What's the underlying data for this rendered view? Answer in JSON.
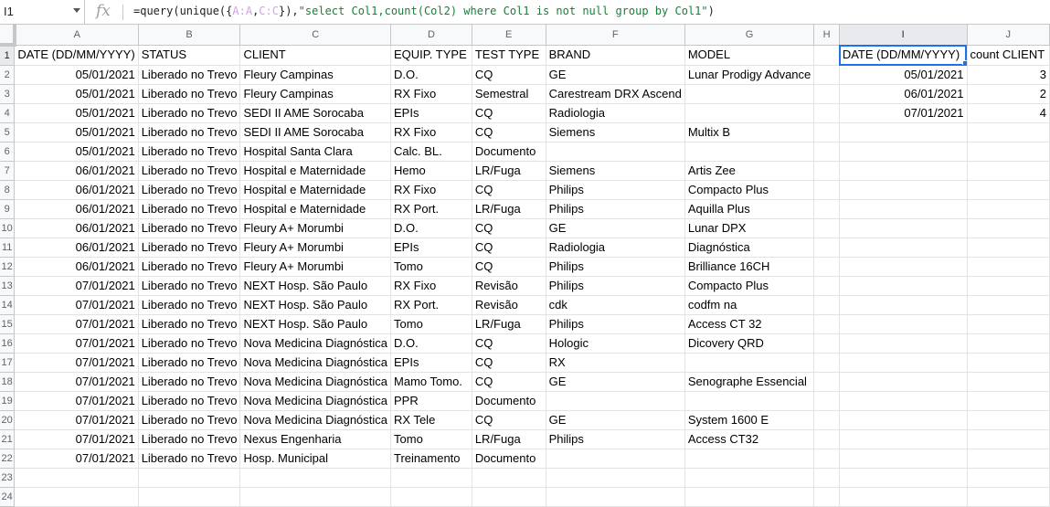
{
  "formula_bar": {
    "name_box": "I1",
    "fx_label": "fx",
    "formula_prefix": "=query(unique({",
    "formula_range1": "A:A",
    "formula_comma": ",",
    "formula_range2": "C:C",
    "formula_mid": "}),",
    "formula_string": "\"select Col1,count(Col2) where Col1 is not null group by Col1\"",
    "formula_end": ")"
  },
  "columns": [
    "A",
    "B",
    "C",
    "D",
    "E",
    "F",
    "G",
    "H",
    "I",
    "J"
  ],
  "rows": [
    [
      "DATE (DD/MM/YYYY)",
      "STATUS",
      "CLIENT",
      "EQUIP. TYPE",
      "TEST TYPE",
      "BRAND",
      "MODEL",
      "",
      "DATE (DD/MM/YYYY)",
      "count CLIENT"
    ],
    [
      "05/01/2021",
      "Liberado no Trevo",
      "Fleury Campinas",
      "D.O.",
      "CQ",
      "GE",
      "Lunar Prodigy Advance",
      "",
      "05/01/2021",
      "3"
    ],
    [
      "05/01/2021",
      "Liberado no Trevo",
      "Fleury Campinas",
      "RX Fixo",
      "Semestral",
      "Carestream DRX Ascend",
      "",
      "",
      "06/01/2021",
      "2"
    ],
    [
      "05/01/2021",
      "Liberado no Trevo",
      "SEDI II AME Sorocaba",
      "EPIs",
      "CQ",
      "Radiologia",
      "",
      "",
      "07/01/2021",
      "4"
    ],
    [
      "05/01/2021",
      "Liberado no Trevo",
      "SEDI II AME Sorocaba",
      "RX Fixo",
      "CQ",
      "Siemens",
      "Multix B",
      "",
      "",
      ""
    ],
    [
      "05/01/2021",
      "Liberado no Trevo",
      "Hospital Santa Clara",
      "Calc. BL.",
      "Documento",
      "",
      "",
      "",
      "",
      ""
    ],
    [
      "06/01/2021",
      "Liberado no Trevo",
      "Hospital e Maternidade",
      "Hemo",
      "LR/Fuga",
      "Siemens",
      "Artis Zee",
      "",
      "",
      ""
    ],
    [
      "06/01/2021",
      "Liberado no Trevo",
      "Hospital e Maternidade",
      "RX Fixo",
      "CQ",
      "Philips",
      "Compacto Plus",
      "",
      "",
      ""
    ],
    [
      "06/01/2021",
      "Liberado no Trevo",
      "Hospital e Maternidade",
      "RX Port.",
      "LR/Fuga",
      "Philips",
      "Aquilla Plus",
      "",
      "",
      ""
    ],
    [
      "06/01/2021",
      "Liberado no Trevo",
      "Fleury A+ Morumbi",
      "D.O.",
      "CQ",
      "GE",
      "Lunar DPX",
      "",
      "",
      ""
    ],
    [
      "06/01/2021",
      "Liberado no Trevo",
      "Fleury A+ Morumbi",
      "EPIs",
      "CQ",
      "Radiologia",
      "Diagnóstica",
      "",
      "",
      ""
    ],
    [
      "06/01/2021",
      "Liberado no Trevo",
      "Fleury A+ Morumbi",
      "Tomo",
      "CQ",
      "Philips",
      "Brilliance 16CH",
      "",
      "",
      ""
    ],
    [
      "07/01/2021",
      "Liberado no Trevo",
      "NEXT Hosp. São Paulo",
      "RX Fixo",
      "Revisão",
      "Philips",
      "Compacto Plus",
      "",
      "",
      ""
    ],
    [
      "07/01/2021",
      "Liberado no Trevo",
      "NEXT Hosp. São Paulo",
      "RX Port.",
      "Revisão",
      "cdk",
      "codfm na",
      "",
      "",
      ""
    ],
    [
      "07/01/2021",
      "Liberado no Trevo",
      "NEXT Hosp. São Paulo",
      "Tomo",
      "LR/Fuga",
      "Philips",
      "Access CT 32",
      "",
      "",
      ""
    ],
    [
      "07/01/2021",
      "Liberado no Trevo",
      "Nova Medicina Diagnóstica",
      "D.O.",
      "CQ",
      "Hologic",
      "Dicovery QRD",
      "",
      "",
      ""
    ],
    [
      "07/01/2021",
      "Liberado no Trevo",
      "Nova Medicina Diagnóstica",
      "EPIs",
      "CQ",
      "RX",
      "",
      "",
      "",
      ""
    ],
    [
      "07/01/2021",
      "Liberado no Trevo",
      "Nova Medicina Diagnóstica",
      "Mamo Tomo.",
      "CQ",
      "GE",
      "Senographe Essencial",
      "",
      "",
      ""
    ],
    [
      "07/01/2021",
      "Liberado no Trevo",
      "Nova Medicina Diagnóstica",
      "PPR",
      "Documento",
      "",
      "",
      "",
      "",
      ""
    ],
    [
      "07/01/2021",
      "Liberado no Trevo",
      "Nova Medicina Diagnóstica",
      "RX Tele",
      "CQ",
      "GE",
      "System 1600 E",
      "",
      "",
      ""
    ],
    [
      "07/01/2021",
      "Liberado no Trevo",
      "Nexus Engenharia",
      "Tomo",
      "LR/Fuga",
      "Philips",
      "Access CT32",
      "",
      "",
      ""
    ],
    [
      "07/01/2021",
      "Liberado no Trevo",
      "Hosp. Municipal",
      "Treinamento",
      "Documento",
      "",
      "",
      "",
      "",
      ""
    ],
    [
      "",
      "",
      "",
      "",
      "",
      "",
      "",
      "",
      "",
      ""
    ],
    [
      "",
      "",
      "",
      "",
      "",
      "",
      "",
      "",
      "",
      ""
    ]
  ],
  "numeric_columns": [
    0,
    8,
    9
  ],
  "selected": {
    "row": 1,
    "col": "I"
  }
}
